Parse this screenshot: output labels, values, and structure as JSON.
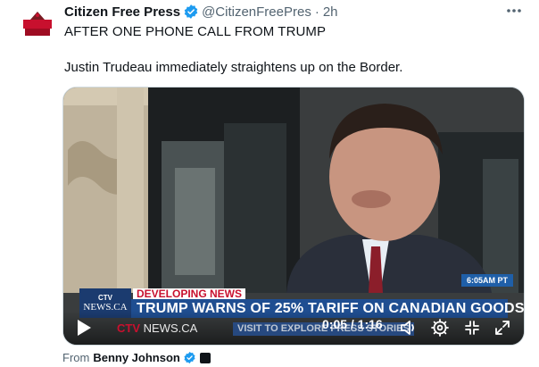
{
  "tweet": {
    "author_name": "Citizen Free Press",
    "handle": "@CitizenFreePres",
    "separator": "·",
    "time_ago": "2h",
    "more_icon": "more-horizontal-icon",
    "text_line1": "AFTER ONE PHONE CALL FROM TRUMP",
    "text_line2": "Justin Trudeau immediately straightens up on the Border.",
    "verified_color": "#1d9bf0"
  },
  "video": {
    "timestamp_badge": "6:05AM PT",
    "channel_logo_small": "CTV",
    "channel_logo_large": "NEWS.CA",
    "kicker": "DEVELOPING NEWS",
    "headline": "TRUMP WARNS OF 25% TARIFF ON CANADIAN GOODS",
    "ticker_brand_ctv": "CTV",
    "ticker_brand_news": "NEWS.CA",
    "ticker_text": "VISIT TO EXPLORE PRESS STORIES",
    "time_display": "0:05 / 1:16",
    "progress_fraction": 0.066,
    "icons": [
      "play-icon",
      "volume-icon",
      "settings-gear-icon",
      "fullscreen-exit-icon",
      "expand-icon"
    ]
  },
  "attribution": {
    "prefix": "From",
    "name": "Benny Johnson"
  }
}
